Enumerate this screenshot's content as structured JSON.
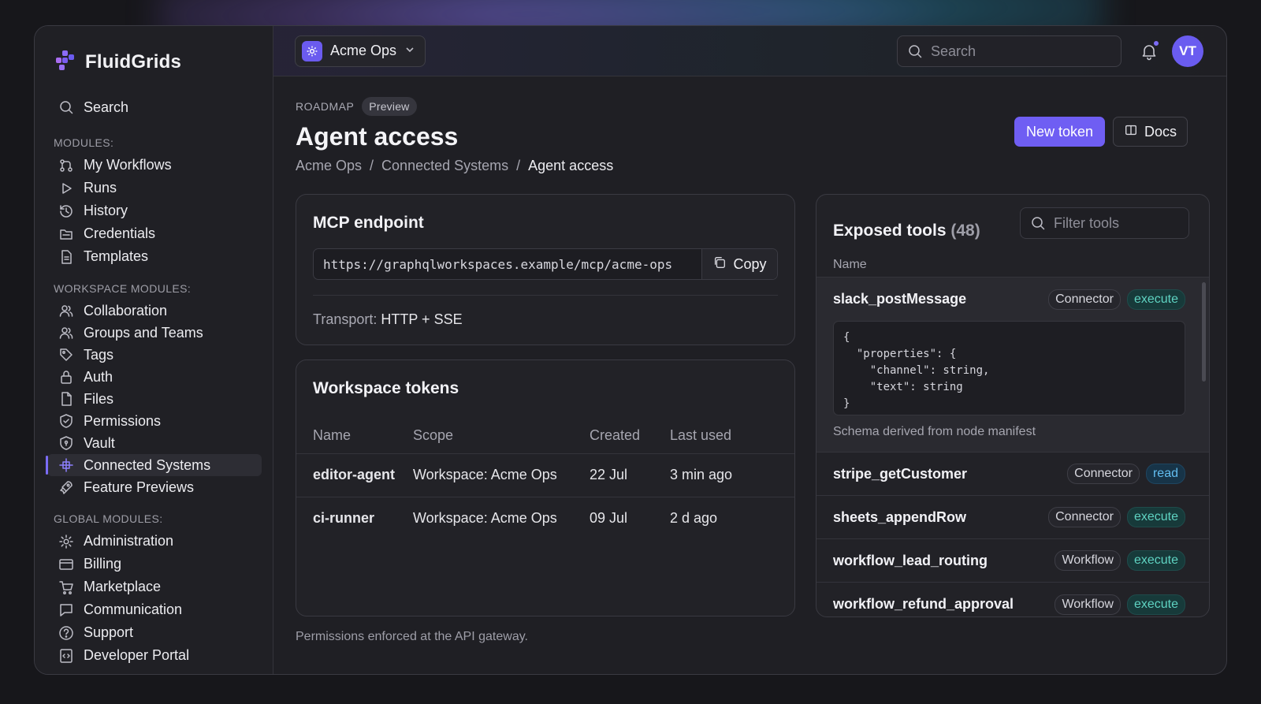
{
  "app": {
    "name": "FluidGrids"
  },
  "sidebar": {
    "search_label": "Search",
    "sections": [
      {
        "title": "MODULES:",
        "items": [
          {
            "label": "My Workflows",
            "icon": "workflow-icon"
          },
          {
            "label": "Runs",
            "icon": "play-icon"
          },
          {
            "label": "History",
            "icon": "history-icon"
          },
          {
            "label": "Credentials",
            "icon": "folder-icon"
          },
          {
            "label": "Templates",
            "icon": "document-icon"
          }
        ]
      },
      {
        "title": "WORKSPACE MODULES:",
        "items": [
          {
            "label": "Collaboration",
            "icon": "users-icon"
          },
          {
            "label": "Groups and Teams",
            "icon": "users-icon"
          },
          {
            "label": "Tags",
            "icon": "tag-icon"
          },
          {
            "label": "Auth",
            "icon": "lock-icon"
          },
          {
            "label": "Files",
            "icon": "file-icon"
          },
          {
            "label": "Permissions",
            "icon": "shield-check-icon"
          },
          {
            "label": "Vault",
            "icon": "shield-icon"
          },
          {
            "label": "Connected Systems",
            "icon": "plug-icon",
            "active": true
          },
          {
            "label": "Feature Previews",
            "icon": "rocket-icon"
          }
        ]
      },
      {
        "title": "GLOBAL MODULES:",
        "items": [
          {
            "label": "Administration",
            "icon": "gear-icon"
          },
          {
            "label": "Billing",
            "icon": "card-icon"
          },
          {
            "label": "Marketplace",
            "icon": "cart-icon"
          },
          {
            "label": "Communication",
            "icon": "chat-icon"
          },
          {
            "label": "Support",
            "icon": "help-icon"
          },
          {
            "label": "Developer Portal",
            "icon": "code-icon"
          }
        ]
      }
    ]
  },
  "topbar": {
    "workspace": "Acme Ops",
    "search_placeholder": "Search",
    "avatar_initials": "VT"
  },
  "page": {
    "eyebrow": "ROADMAP",
    "badge": "Preview",
    "title": "Agent access",
    "breadcrumb": [
      "Acme Ops",
      "Connected Systems",
      "Agent access"
    ],
    "primary_action": "New token",
    "secondary_action": "Docs",
    "footnote": "Permissions enforced at the API gateway."
  },
  "mcp": {
    "title": "MCP endpoint",
    "url": "https://graphqlworkspaces.example/mcp/acme-ops",
    "copy_label": "Copy",
    "transport_label": "Transport:",
    "transport_value": "HTTP + SSE"
  },
  "tokens": {
    "title": "Workspace tokens",
    "columns": [
      "Name",
      "Scope",
      "Created",
      "Last used"
    ],
    "rows": [
      {
        "name": "editor-agent",
        "scope": "Workspace: Acme Ops",
        "created": "22 Jul",
        "last_used": "3 min ago"
      },
      {
        "name": "ci-runner",
        "scope": "Workspace: Acme Ops",
        "created": "09 Jul",
        "last_used": "2 d ago"
      }
    ]
  },
  "tools": {
    "title": "Exposed tools",
    "count": "(48)",
    "filter_placeholder": "Filter tools",
    "column": "Name",
    "expanded": {
      "name": "slack_postMessage",
      "kind": "Connector",
      "perm": "execute",
      "schema": "{\n  \"properties\": {\n    \"channel\": string,\n    \"text\": string\n}",
      "note": "Schema derived from node manifest"
    },
    "rows": [
      {
        "name": "stripe_getCustomer",
        "kind": "Connector",
        "perm": "read"
      },
      {
        "name": "sheets_appendRow",
        "kind": "Connector",
        "perm": "execute"
      },
      {
        "name": "workflow_lead_routing",
        "kind": "Workflow",
        "perm": "execute"
      },
      {
        "name": "workflow_refund_approval",
        "kind": "Workflow",
        "perm": "execute"
      }
    ]
  },
  "colors": {
    "accent": "#6f5ef3",
    "execute": "#5fd3c2",
    "read": "#62bdf0"
  }
}
